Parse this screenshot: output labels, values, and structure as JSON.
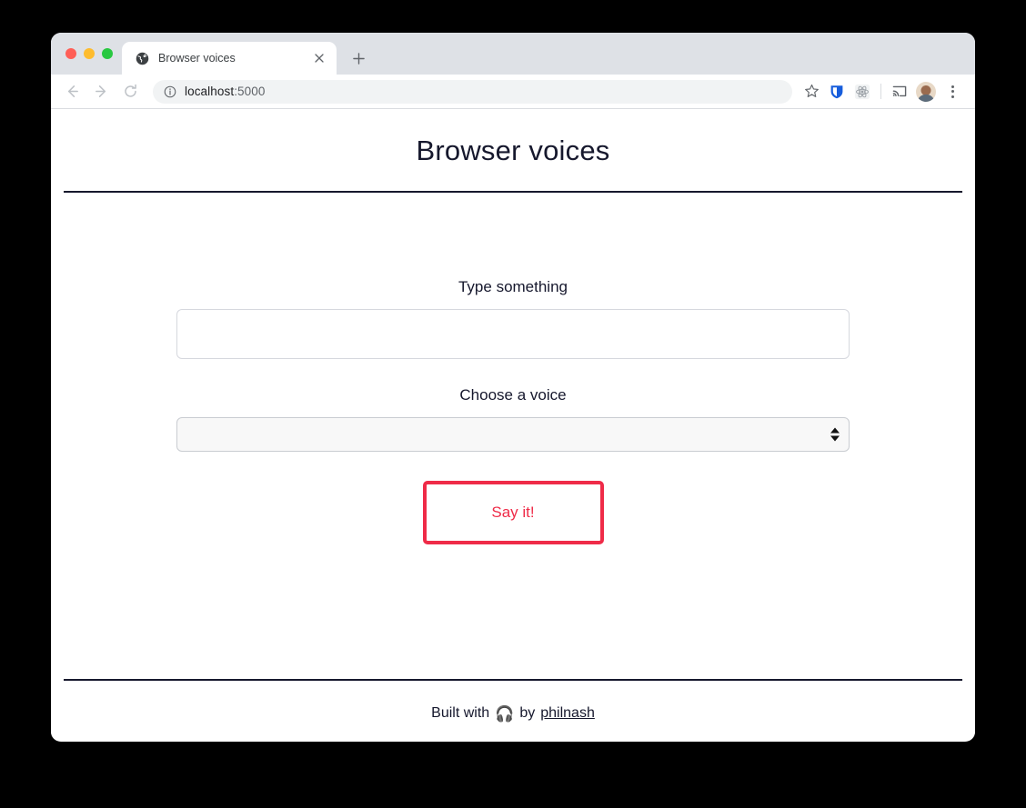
{
  "browser": {
    "traffic_lights": [
      "close",
      "minimize",
      "maximize"
    ],
    "tab": {
      "title": "Browser voices",
      "favicon": "globe-icon",
      "close_label": "×"
    },
    "new_tab_label": "+",
    "nav": {
      "back": "←",
      "forward": "→",
      "reload": "⟳"
    },
    "omnibox": {
      "info_icon": "info-circle-icon",
      "url_host": "localhost",
      "url_port": ":5000"
    },
    "toolbar_icons": [
      {
        "name": "bookmark-star-icon",
        "glyph": "☆"
      },
      {
        "name": "bitwarden-shield-icon",
        "glyph": "shield"
      },
      {
        "name": "react-devtools-icon",
        "glyph": "atom"
      },
      {
        "name": "cast-icon",
        "glyph": "cast"
      },
      {
        "name": "profile-avatar",
        "glyph": "avatar"
      },
      {
        "name": "chrome-menu-icon",
        "glyph": "kebab"
      }
    ]
  },
  "page": {
    "title": "Browser voices",
    "form": {
      "text_label": "Type something",
      "text_value": "",
      "text_placeholder": "",
      "voice_label": "Choose a voice",
      "voice_selected": "",
      "voice_options": [],
      "submit_label": "Say it!"
    },
    "footer": {
      "built_with": "Built with",
      "emoji": "🎧",
      "by": "by",
      "author": "philnash"
    }
  },
  "colors": {
    "accent_red": "#ef2b48",
    "text_dark": "#16182d",
    "tab_strip": "#dee1e6",
    "omnibox_bg": "#f1f3f4",
    "page_bg": "#ffffff",
    "backdrop": "#000000"
  }
}
